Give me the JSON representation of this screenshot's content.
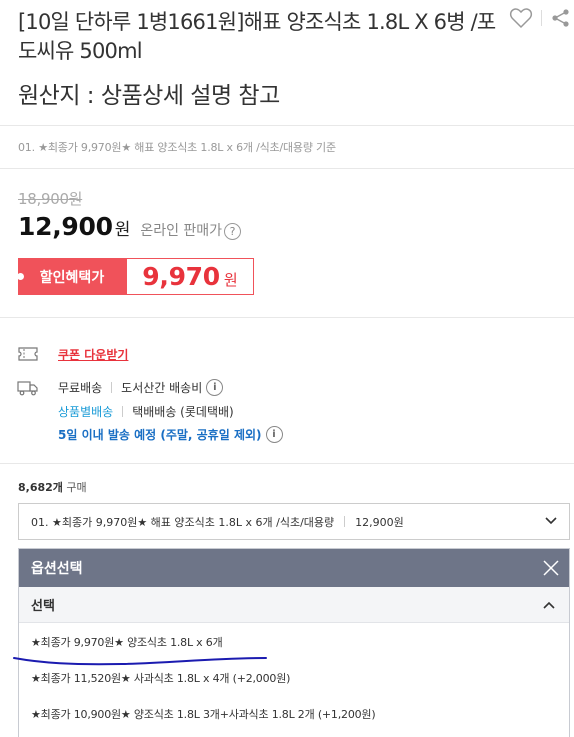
{
  "product": {
    "title": "[10일 단하루 1병1661원]해표 양조식초 1.8L X 6병 /포도씨유 500ml",
    "origin": "원산지 : 상품상세 설명 참고",
    "option_summary": "01. ★최종가 9,970원★ 해표 양조식초 1.8L x 6개 /식초/대용량 기준"
  },
  "icons": {
    "wishlist": "heart-icon",
    "share": "share-icon",
    "coupon": "coupon-icon",
    "shipping": "truck-icon",
    "info": "info-icon",
    "help": "question-icon",
    "chevron_down": "chevron-down-icon",
    "chevron_up": "chevron-up-icon",
    "close": "close-icon"
  },
  "price": {
    "original": "18,900원",
    "online": "12,900",
    "online_unit": "원",
    "online_label": "온라인 판매가",
    "help_icon": "?",
    "discount_label": "할인혜택가",
    "discount": "9,970",
    "discount_unit": "원"
  },
  "coupon": {
    "label": "쿠폰 다운받기"
  },
  "shipping": {
    "free": "무료배송",
    "island_fee": "도서산간 배송비",
    "info_icon": "i",
    "per_item": "상품별배송",
    "courier": "택배배송 (롯데택배)",
    "schedule": "5일 이내 발송 예정 (주말, 공휴일 제외)"
  },
  "purchase": {
    "count": "8,682개",
    "count_label": "구매"
  },
  "select": {
    "current_option": "01. ★최종가 9,970원★ 해표 양조식초 1.8L x 6개 /식초/대용량",
    "current_price": "12,900원"
  },
  "option_panel": {
    "title": "옵션선택",
    "sub_title": "선택",
    "items": [
      "★최종가 9,970원★ 양조식초 1.8L x 6개",
      "★최종가 11,520원★ 사과식초 1.8L x 4개 (+2,000원)",
      "★최종가 10,900원★ 양조식초 1.8L 3개+사과식초 1.8L 2개 (+1,200원)"
    ]
  },
  "colors": {
    "accent_red": "#f0525a",
    "price_red": "#e8333c",
    "link_blue": "#1a9bd7",
    "schedule_blue": "#1a6fc4",
    "panel_header": "#6e7588",
    "annotation_ink": "#1b1bb0"
  }
}
